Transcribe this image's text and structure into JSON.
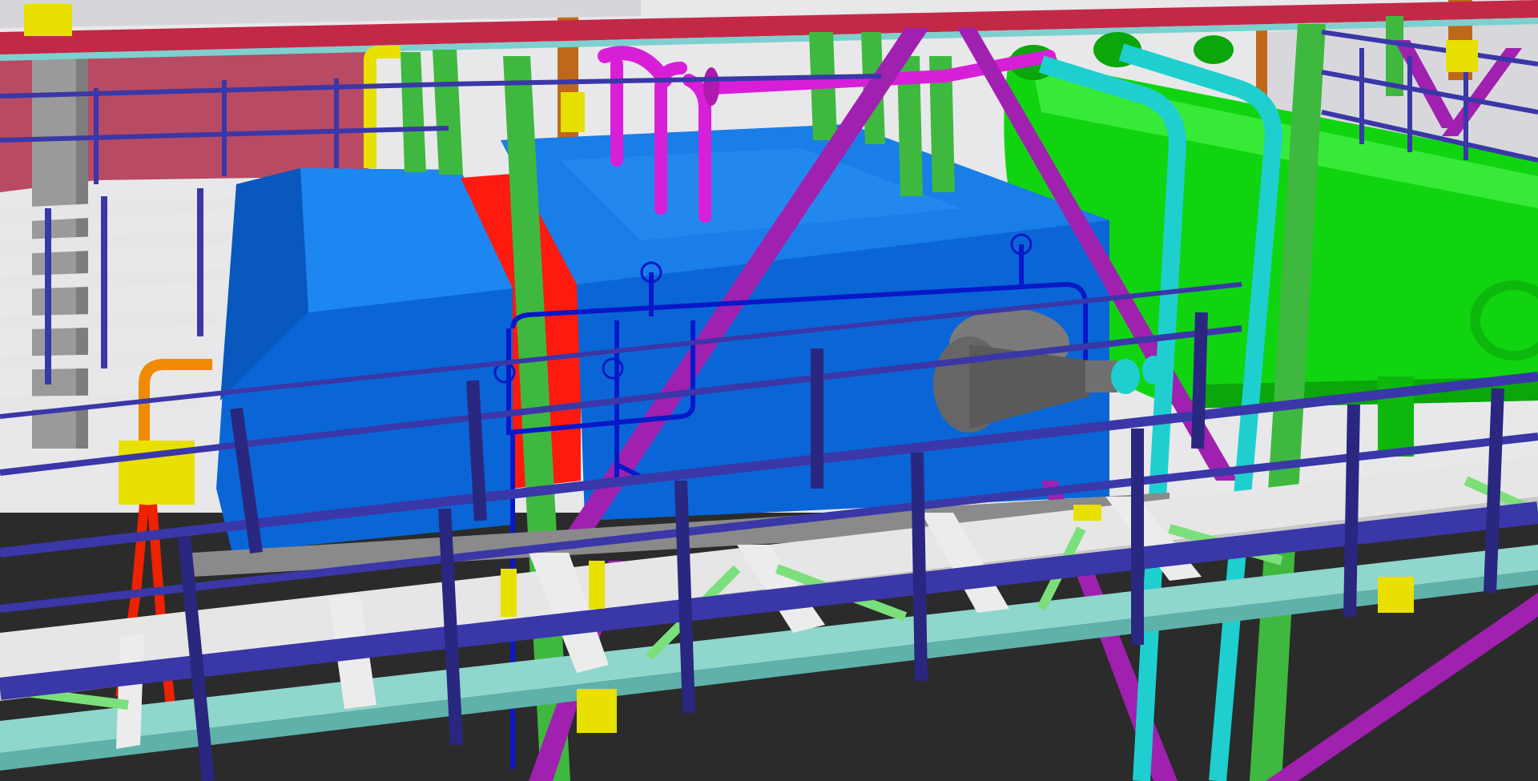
{
  "scene": {
    "kind": "3d-plant-model-render",
    "objects": [
      "structural-steel-frame",
      "handrail",
      "grating-walkway",
      "tank-enclosure",
      "pressure-vessel",
      "diagonal-brace",
      "piping",
      "burner-assembly",
      "hand-valve"
    ]
  },
  "colors": {
    "background_sky": "#e8e8ea",
    "floor_shadow": "#2b2b2b",
    "handrail": "#3a37a8",
    "handrail_shade": "#2a2780",
    "top_beam": "#c42847",
    "wall_panel": "#b84a63",
    "walkway_beam": "#8fd6cc",
    "grating": "#e6e6e6",
    "tank_main": "#0a66d6",
    "tank_top": "#1e86f0",
    "tank_dark": "#0550b0",
    "tank_red_band": "#ff1a10",
    "vessel_green": "#11d411",
    "vessel_green_dark": "#0aa60a",
    "column_green": "#3fb83f",
    "brace_magenta": "#a020b0",
    "pipe_magenta": "#d81fd8",
    "pipe_cyan": "#1fcfcf",
    "pipe_blue": "#0818c8",
    "pipe_orange": "#f08a00",
    "pipe_red": "#ee2200",
    "pipe_yellow": "#e8e000",
    "column_grey": "#9a9a9a",
    "burner_grey": "#666666",
    "light_green_brace": "#7be07b",
    "brown_column": "#c0681a"
  }
}
